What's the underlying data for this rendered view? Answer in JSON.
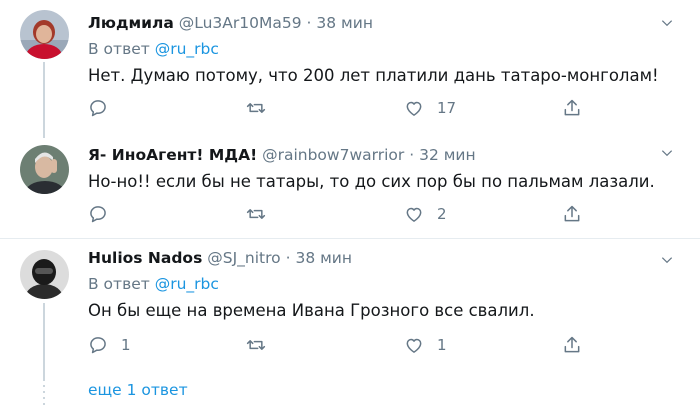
{
  "tweets": [
    {
      "name": "Людмила",
      "handle": "@Lu3Ar10Ma59",
      "separator": "·",
      "time": "38 мин",
      "reply_prefix": "В ответ",
      "reply_mention": "@ru_rbc",
      "text": "Нет. Думаю потому, что 200 лет платили дань татаро-монголам!",
      "replies": "",
      "retweets": "",
      "likes": "17"
    },
    {
      "name": "Я- ИноАгент! МДА!",
      "handle": "@rainbow7warrior",
      "separator": "·",
      "time": "32 мин",
      "text": "Но-но!! если бы не татары, то до сих пор бы по пальмам лазали.",
      "replies": "",
      "retweets": "",
      "likes": "2"
    },
    {
      "name": "Hulios Nados",
      "handle": "@SJ_nitro",
      "separator": "·",
      "time": "38 мин",
      "reply_prefix": "В ответ",
      "reply_mention": "@ru_rbc",
      "text": "Он бы еще на времена Ивана Грозного все свалил.",
      "replies": "1",
      "retweets": "",
      "likes": "1"
    }
  ],
  "more_replies": "еще 1 ответ",
  "colors": {
    "accent": "#1b95e0",
    "muted": "#657786",
    "separator": "#e6ecf0"
  },
  "icons": [
    "reply-icon",
    "retweet-icon",
    "like-icon",
    "share-icon",
    "chevron-down-icon"
  ]
}
